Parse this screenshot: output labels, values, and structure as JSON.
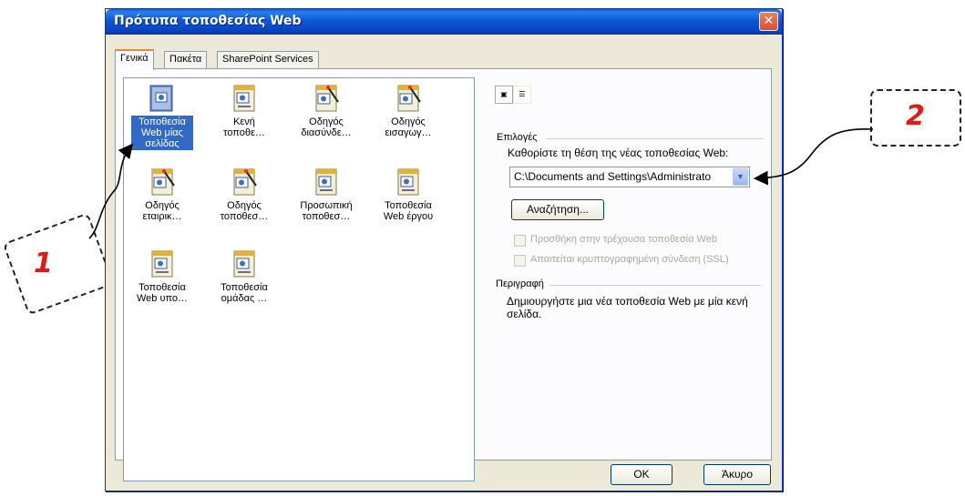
{
  "window": {
    "title": "Πρότυπα τοποθεσίας Web",
    "close_glyph": "✕"
  },
  "tabs": [
    {
      "label": "Γενικά",
      "active": true
    },
    {
      "label": "Πακέτα",
      "active": false
    },
    {
      "label": "SharePoint Services",
      "active": false
    }
  ],
  "templates": [
    {
      "label": "Τοποθεσία Web μίας σελίδας",
      "icon": "single-page-site-icon",
      "selected": true
    },
    {
      "label": "Κενή τοποθε…",
      "icon": "blank-site-icon",
      "selected": false
    },
    {
      "label": "Οδηγός διασύνδε…",
      "icon": "wizard-icon",
      "selected": false
    },
    {
      "label": "Οδηγός εισαγωγ…",
      "icon": "import-wizard-icon",
      "selected": false
    },
    {
      "label": "Οδηγός εταιρικ…",
      "icon": "corporate-wizard-icon",
      "selected": false
    },
    {
      "label": "Οδηγός τοποθεσ…",
      "icon": "site-wizard-icon",
      "selected": false
    },
    {
      "label": "Προσωπική τοποθεσ…",
      "icon": "personal-site-icon",
      "selected": false
    },
    {
      "label": "Τοποθεσία Web έργου",
      "icon": "project-site-icon",
      "selected": false
    },
    {
      "label": "Τοποθεσία Web υπο…",
      "icon": "support-site-icon",
      "selected": false
    },
    {
      "label": "Τοποθεσία ομάδας …",
      "icon": "team-site-icon",
      "selected": false
    }
  ],
  "options": {
    "group_label": "Επιλογές",
    "location_prompt": "Καθορίστε τη θέση της νέας τοποθεσίας Web:",
    "location_value": "C:\\Documents and Settings\\Administrato",
    "browse_label": "Αναζήτηση...",
    "add_to_current_label": "Προσθήκη στην τρέχουσα τοποθεσία Web",
    "ssl_label": "Απαιτείται κρυπτογραφημένη σύνδεση (SSL)"
  },
  "description": {
    "group_label": "Περιγραφή",
    "text": "Δημιουργήστε μια νέα τοποθεσία Web με μία κενή σελίδα."
  },
  "footer": {
    "ok_label": "OK",
    "cancel_label": "Άκυρο"
  },
  "annotations": [
    {
      "number": "1"
    },
    {
      "number": "2"
    }
  ],
  "colors": {
    "title_bar": "#0a5fd8",
    "selection": "#316ac5",
    "callout_number": "#e21b12"
  }
}
